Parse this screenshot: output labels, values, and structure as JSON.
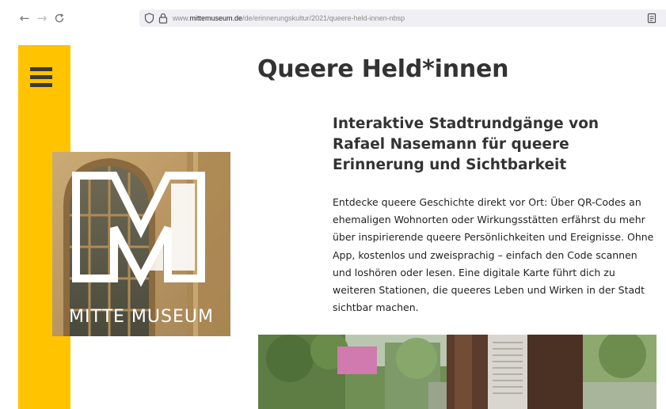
{
  "browser": {
    "url_prefix": "www.",
    "url_domain": "mittemuseum.de",
    "url_path": "/de/erinnerungskultur/2021/queere-held-innen-nbsp",
    "back_symbol": "←",
    "forward_symbol": "→",
    "reload_symbol": "C"
  },
  "sidebar": {
    "menu_icon": "hamburger-menu-icon",
    "color": "#ffc300"
  },
  "logo": {
    "wordmark": "MITTE MUSEUM"
  },
  "article": {
    "title": "Queere Held*innen",
    "subtitle": "Interaktive Stadtrundgänge von Rafael Nasemann für queere Erinnerung und Sichtbarkeit",
    "body": "Entdecke queere Geschichte direkt vor Ort: Über QR-Codes an ehemaligen Wohnorten oder Wirkungsstätten erfährst du mehr über inspirierende queere Persönlichkeiten und Ereignisse. Ohne App, kostenlos und zweisprachig – einfach den Code scannen und loshören oder lesen. Eine digitale Karte führt dich zu weiteren Stationen, die queeres Leben und Wirken in der Stadt sichtbar machen."
  }
}
